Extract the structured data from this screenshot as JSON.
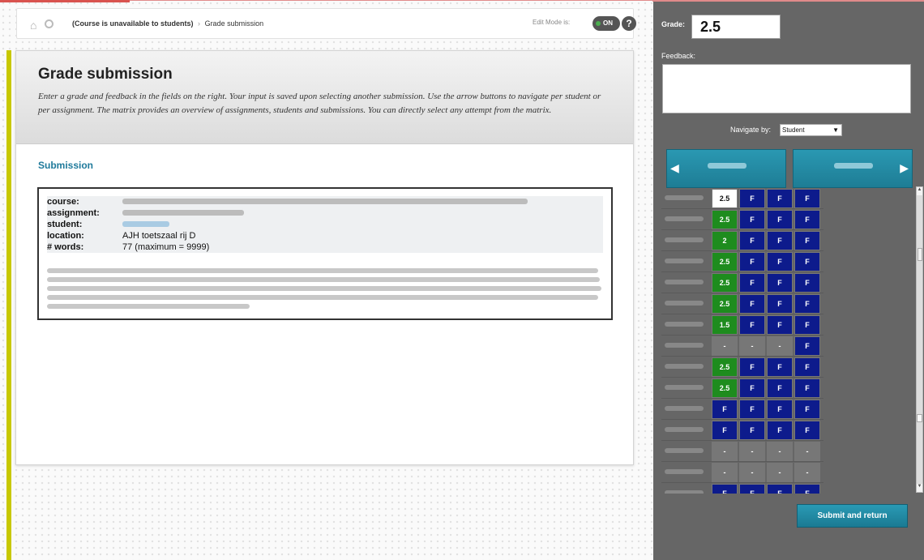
{
  "breadcrumb": {
    "course": "(Course is unavailable to students)",
    "separator": "›",
    "current": "Grade submission",
    "edit_mode_label": "Edit Mode is:",
    "edit_mode_state": "ON",
    "help_label": "?"
  },
  "main": {
    "title": "Grade submission",
    "description": "Enter a grade and feedback in the fields on the right. Your input is saved upon selecting another submission. Use the arrow buttons to navigate per student or per assignment. The matrix provides an overview of assignments, students and submissions. You can directly select any attempt from the matrix.",
    "section_title": "Submission",
    "fields": [
      {
        "key": "course:",
        "value": ""
      },
      {
        "key": "assignment:",
        "value": ""
      },
      {
        "key": "student:",
        "value": ""
      },
      {
        "key": "location:",
        "value": "AJH toetszaal rij D"
      },
      {
        "key": "# words:",
        "value": "77 (maximum = 9999)"
      }
    ]
  },
  "sidebar": {
    "grade_label": "Grade:",
    "grade_value": "2.5",
    "feedback_label": "Feedback:",
    "feedback_value": "",
    "navigate_label": "Navigate by:",
    "navigate_value": "Student",
    "prev_icon": "◀",
    "next_icon": "▶",
    "submit_label": "Submit and return"
  },
  "matrix": {
    "colors": {
      "selected": "#ffffff",
      "graded": "#1e8c1e",
      "failed": "#0d1b8c",
      "empty": "#777777"
    },
    "rows": [
      {
        "cells": [
          {
            "v": "2.5",
            "s": "selected"
          },
          {
            "v": "F",
            "s": "failed"
          },
          {
            "v": "F",
            "s": "failed"
          },
          {
            "v": "F",
            "s": "failed"
          }
        ]
      },
      {
        "cells": [
          {
            "v": "2.5",
            "s": "graded"
          },
          {
            "v": "F",
            "s": "failed"
          },
          {
            "v": "F",
            "s": "failed"
          },
          {
            "v": "F",
            "s": "failed"
          }
        ]
      },
      {
        "cells": [
          {
            "v": "2",
            "s": "graded"
          },
          {
            "v": "F",
            "s": "failed"
          },
          {
            "v": "F",
            "s": "failed"
          },
          {
            "v": "F",
            "s": "failed"
          }
        ]
      },
      {
        "cells": [
          {
            "v": "2.5",
            "s": "graded"
          },
          {
            "v": "F",
            "s": "failed"
          },
          {
            "v": "F",
            "s": "failed"
          },
          {
            "v": "F",
            "s": "failed"
          }
        ]
      },
      {
        "cells": [
          {
            "v": "2.5",
            "s": "graded"
          },
          {
            "v": "F",
            "s": "failed"
          },
          {
            "v": "F",
            "s": "failed"
          },
          {
            "v": "F",
            "s": "failed"
          }
        ]
      },
      {
        "cells": [
          {
            "v": "2.5",
            "s": "graded"
          },
          {
            "v": "F",
            "s": "failed"
          },
          {
            "v": "F",
            "s": "failed"
          },
          {
            "v": "F",
            "s": "failed"
          }
        ]
      },
      {
        "cells": [
          {
            "v": "1.5",
            "s": "graded"
          },
          {
            "v": "F",
            "s": "failed"
          },
          {
            "v": "F",
            "s": "failed"
          },
          {
            "v": "F",
            "s": "failed"
          }
        ]
      },
      {
        "cells": [
          {
            "v": "-",
            "s": "empty"
          },
          {
            "v": "-",
            "s": "empty"
          },
          {
            "v": "-",
            "s": "empty"
          },
          {
            "v": "F",
            "s": "failed"
          }
        ]
      },
      {
        "cells": [
          {
            "v": "2.5",
            "s": "graded"
          },
          {
            "v": "F",
            "s": "failed"
          },
          {
            "v": "F",
            "s": "failed"
          },
          {
            "v": "F",
            "s": "failed"
          }
        ]
      },
      {
        "cells": [
          {
            "v": "2.5",
            "s": "graded"
          },
          {
            "v": "F",
            "s": "failed"
          },
          {
            "v": "F",
            "s": "failed"
          },
          {
            "v": "F",
            "s": "failed"
          }
        ]
      },
      {
        "cells": [
          {
            "v": "F",
            "s": "failed"
          },
          {
            "v": "F",
            "s": "failed"
          },
          {
            "v": "F",
            "s": "failed"
          },
          {
            "v": "F",
            "s": "failed"
          }
        ]
      },
      {
        "cells": [
          {
            "v": "F",
            "s": "failed"
          },
          {
            "v": "F",
            "s": "failed"
          },
          {
            "v": "F",
            "s": "failed"
          },
          {
            "v": "F",
            "s": "failed"
          }
        ]
      },
      {
        "cells": [
          {
            "v": "-",
            "s": "empty"
          },
          {
            "v": "-",
            "s": "empty"
          },
          {
            "v": "-",
            "s": "empty"
          },
          {
            "v": "-",
            "s": "empty"
          }
        ]
      },
      {
        "cells": [
          {
            "v": "-",
            "s": "empty"
          },
          {
            "v": "-",
            "s": "empty"
          },
          {
            "v": "-",
            "s": "empty"
          },
          {
            "v": "-",
            "s": "empty"
          }
        ]
      },
      {
        "cells": [
          {
            "v": "F",
            "s": "failed"
          },
          {
            "v": "F",
            "s": "failed"
          },
          {
            "v": "F",
            "s": "failed"
          },
          {
            "v": "F",
            "s": "failed"
          }
        ]
      }
    ]
  }
}
